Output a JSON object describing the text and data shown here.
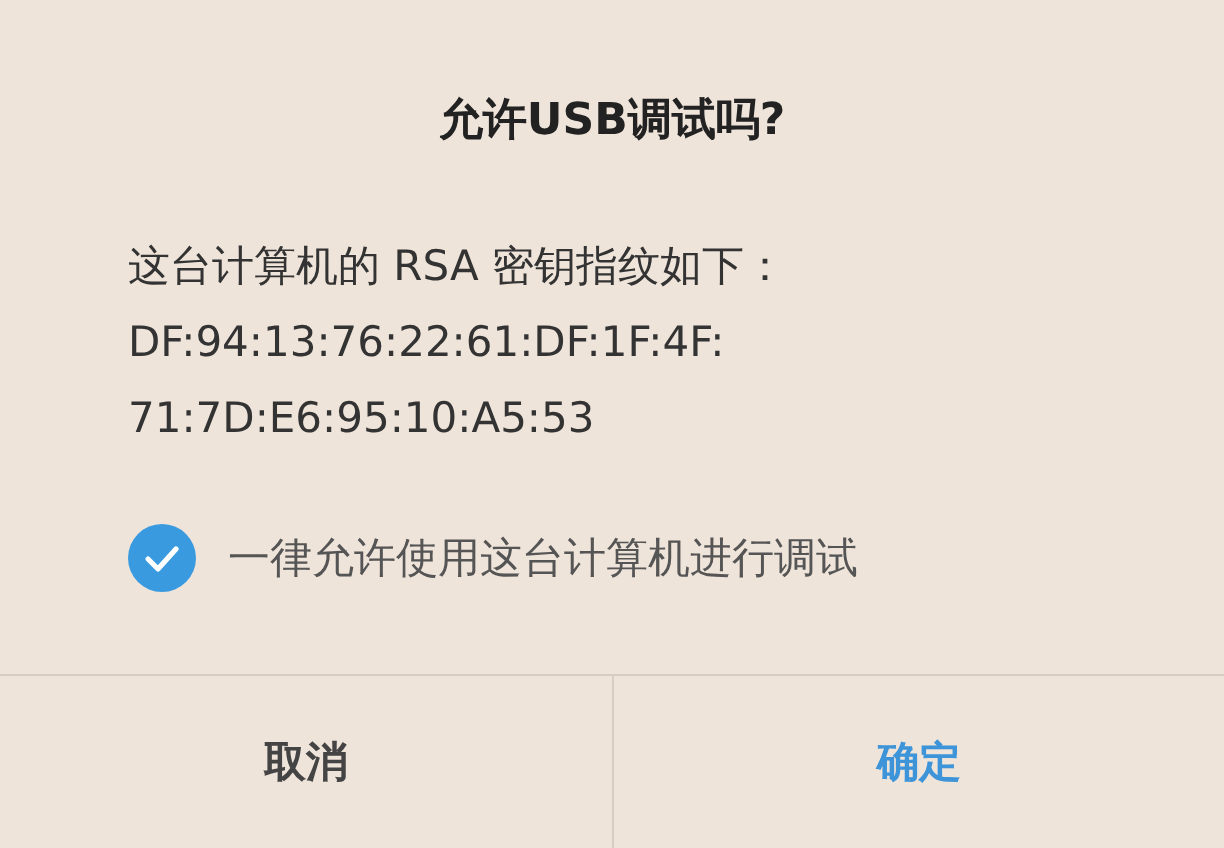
{
  "dialog": {
    "title": "允许USB调试吗?",
    "message": "这台计算机的 RSA 密钥指纹如下：",
    "fingerprint_lines": [
      "DF:94:13:76:22:61:DF:1F:4F:",
      "71:7D:E6:95:10:A5:53"
    ],
    "always_allow": {
      "label": "一律允许使用这台计算机进行调试",
      "checked": true
    },
    "buttons": [
      {
        "label": "取消",
        "kind": "cancel"
      },
      {
        "label": "确定",
        "kind": "confirm"
      }
    ]
  }
}
